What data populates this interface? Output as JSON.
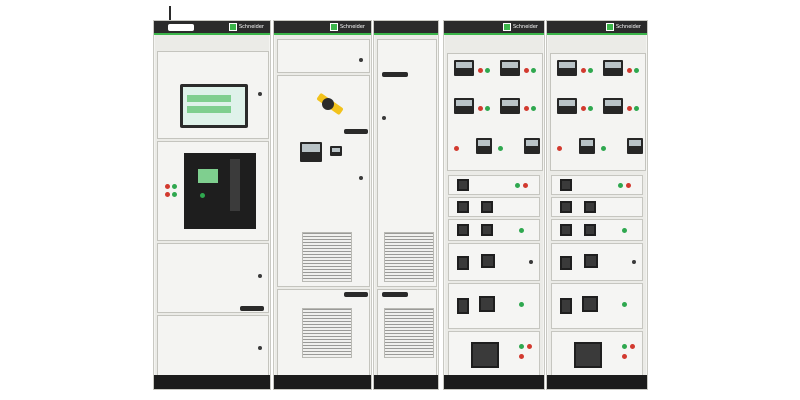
{
  "brand": {
    "text": "Schneider",
    "accent_color": "#3bb54a"
  },
  "colors": {
    "frame": "#2b2b2b",
    "body": "#ebebe7",
    "door": "#f4f4f2",
    "led_red": "#d23a2f",
    "led_green": "#2fa84f",
    "handle": "#f2c21c"
  },
  "icons": {
    "logo": "schneider-logo-icon",
    "vent": "vent-grille-icon"
  },
  "cabinets": [
    {
      "name": "incomer-cabinet"
    },
    {
      "name": "power-cabinet-left"
    },
    {
      "name": "power-cabinet-right"
    },
    {
      "name": "mcc-cabinet-1"
    },
    {
      "name": "mcc-cabinet-2"
    }
  ]
}
